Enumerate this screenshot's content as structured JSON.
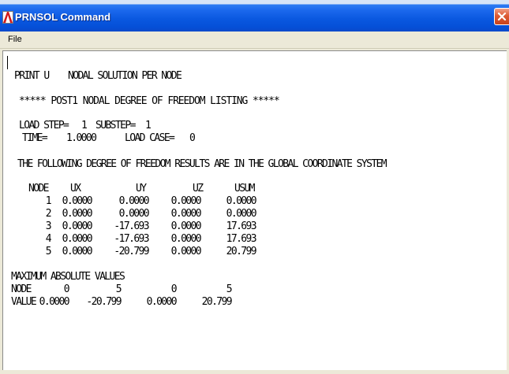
{
  "window": {
    "title": "PRNSOL Command",
    "icon": "ansys-logo-icon",
    "close_icon": "close-icon"
  },
  "menu": {
    "items": [
      "File"
    ]
  },
  "output": {
    "heading_cmd": "PRINT U",
    "heading_title": "NODAL SOLUTION PER NODE",
    "banner": "***** POST1 NODAL DEGREE OF FREEDOM LISTING *****",
    "load_step_label": "LOAD STEP=",
    "load_step_value": "1",
    "substep_label": "SUBSTEP=",
    "substep_value": "1",
    "time_label": "TIME=",
    "time_value": "1.0000",
    "load_case_label": "LOAD CASE=",
    "load_case_value": "0",
    "coord_note": "THE FOLLOWING DEGREE OF FREEDOM RESULTS ARE IN THE GLOBAL COORDINATE SYSTEM",
    "table": {
      "columns": [
        "NODE",
        "UX",
        "UY",
        "UZ",
        "USUM"
      ],
      "rows": [
        [
          "1",
          "0.0000",
          "0.0000",
          "0.0000",
          "0.0000"
        ],
        [
          "2",
          "0.0000",
          "0.0000",
          "0.0000",
          "0.0000"
        ],
        [
          "3",
          "0.0000",
          "-17.693",
          "0.0000",
          "17.693"
        ],
        [
          "4",
          "0.0000",
          "-17.693",
          "0.0000",
          "17.693"
        ],
        [
          "5",
          "0.0000",
          "-20.799",
          "0.0000",
          "20.799"
        ]
      ]
    },
    "max": {
      "title": "MAXIMUM ABSOLUTE VALUES",
      "node_label": "NODE",
      "nodes": [
        "0",
        "5",
        "0",
        "5"
      ],
      "value_label": "VALUE",
      "values": [
        "0.0000",
        "-20.799",
        "0.0000",
        "20.799"
      ]
    }
  },
  "colors": {
    "title_bar": "#0550D8",
    "close_button": "#DD5A34",
    "menu_bar": "#ECE9D8",
    "output_background": "#FFFFFF",
    "text": "#000000"
  }
}
